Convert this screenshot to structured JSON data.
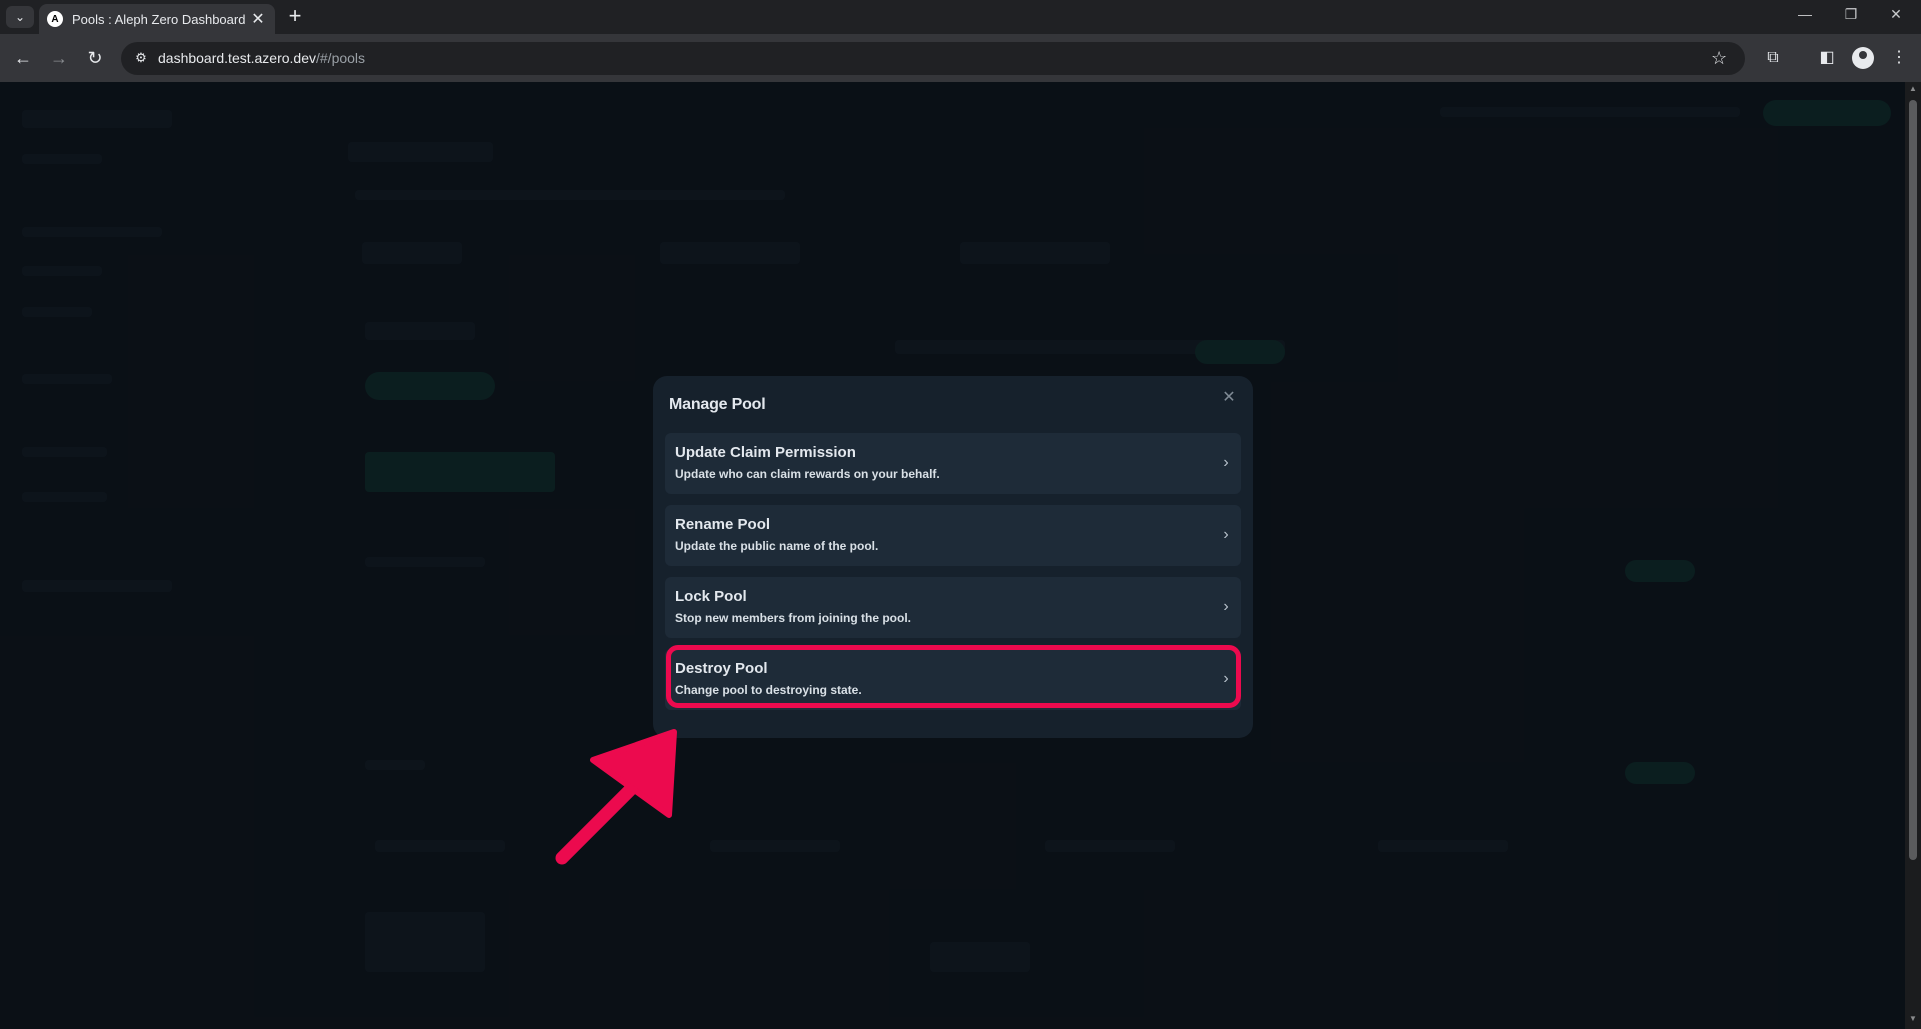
{
  "browser": {
    "tab_title": "Pools : Aleph Zero Dashboard",
    "favicon_letter": "A",
    "url_host": "dashboard.test.azero.dev",
    "url_path": "/#/pools",
    "tab_close": "✕",
    "new_tab": "+",
    "tab_menu": "⌄",
    "back": "←",
    "forward": "→",
    "reload": "↻",
    "minimize": "—",
    "restore": "❐",
    "window_close": "✕",
    "star": "☆",
    "extensions": "⧉",
    "sidepanel": "◧",
    "menu": "⋮"
  },
  "modal": {
    "title": "Manage Pool",
    "close_glyph": "✕",
    "options": [
      {
        "title": "Update Claim Permission",
        "description": "Update who can claim rewards on your behalf."
      },
      {
        "title": "Rename Pool",
        "description": "Update the public name of the pool."
      },
      {
        "title": "Lock Pool",
        "description": "Stop new members from joining the pool."
      },
      {
        "title": "Destroy Pool",
        "description": "Change pool to destroying state."
      }
    ],
    "chevron": "›"
  },
  "annotation": {
    "highlighted_option": "Destroy Pool",
    "highlight_color": "#ec0a4e"
  }
}
